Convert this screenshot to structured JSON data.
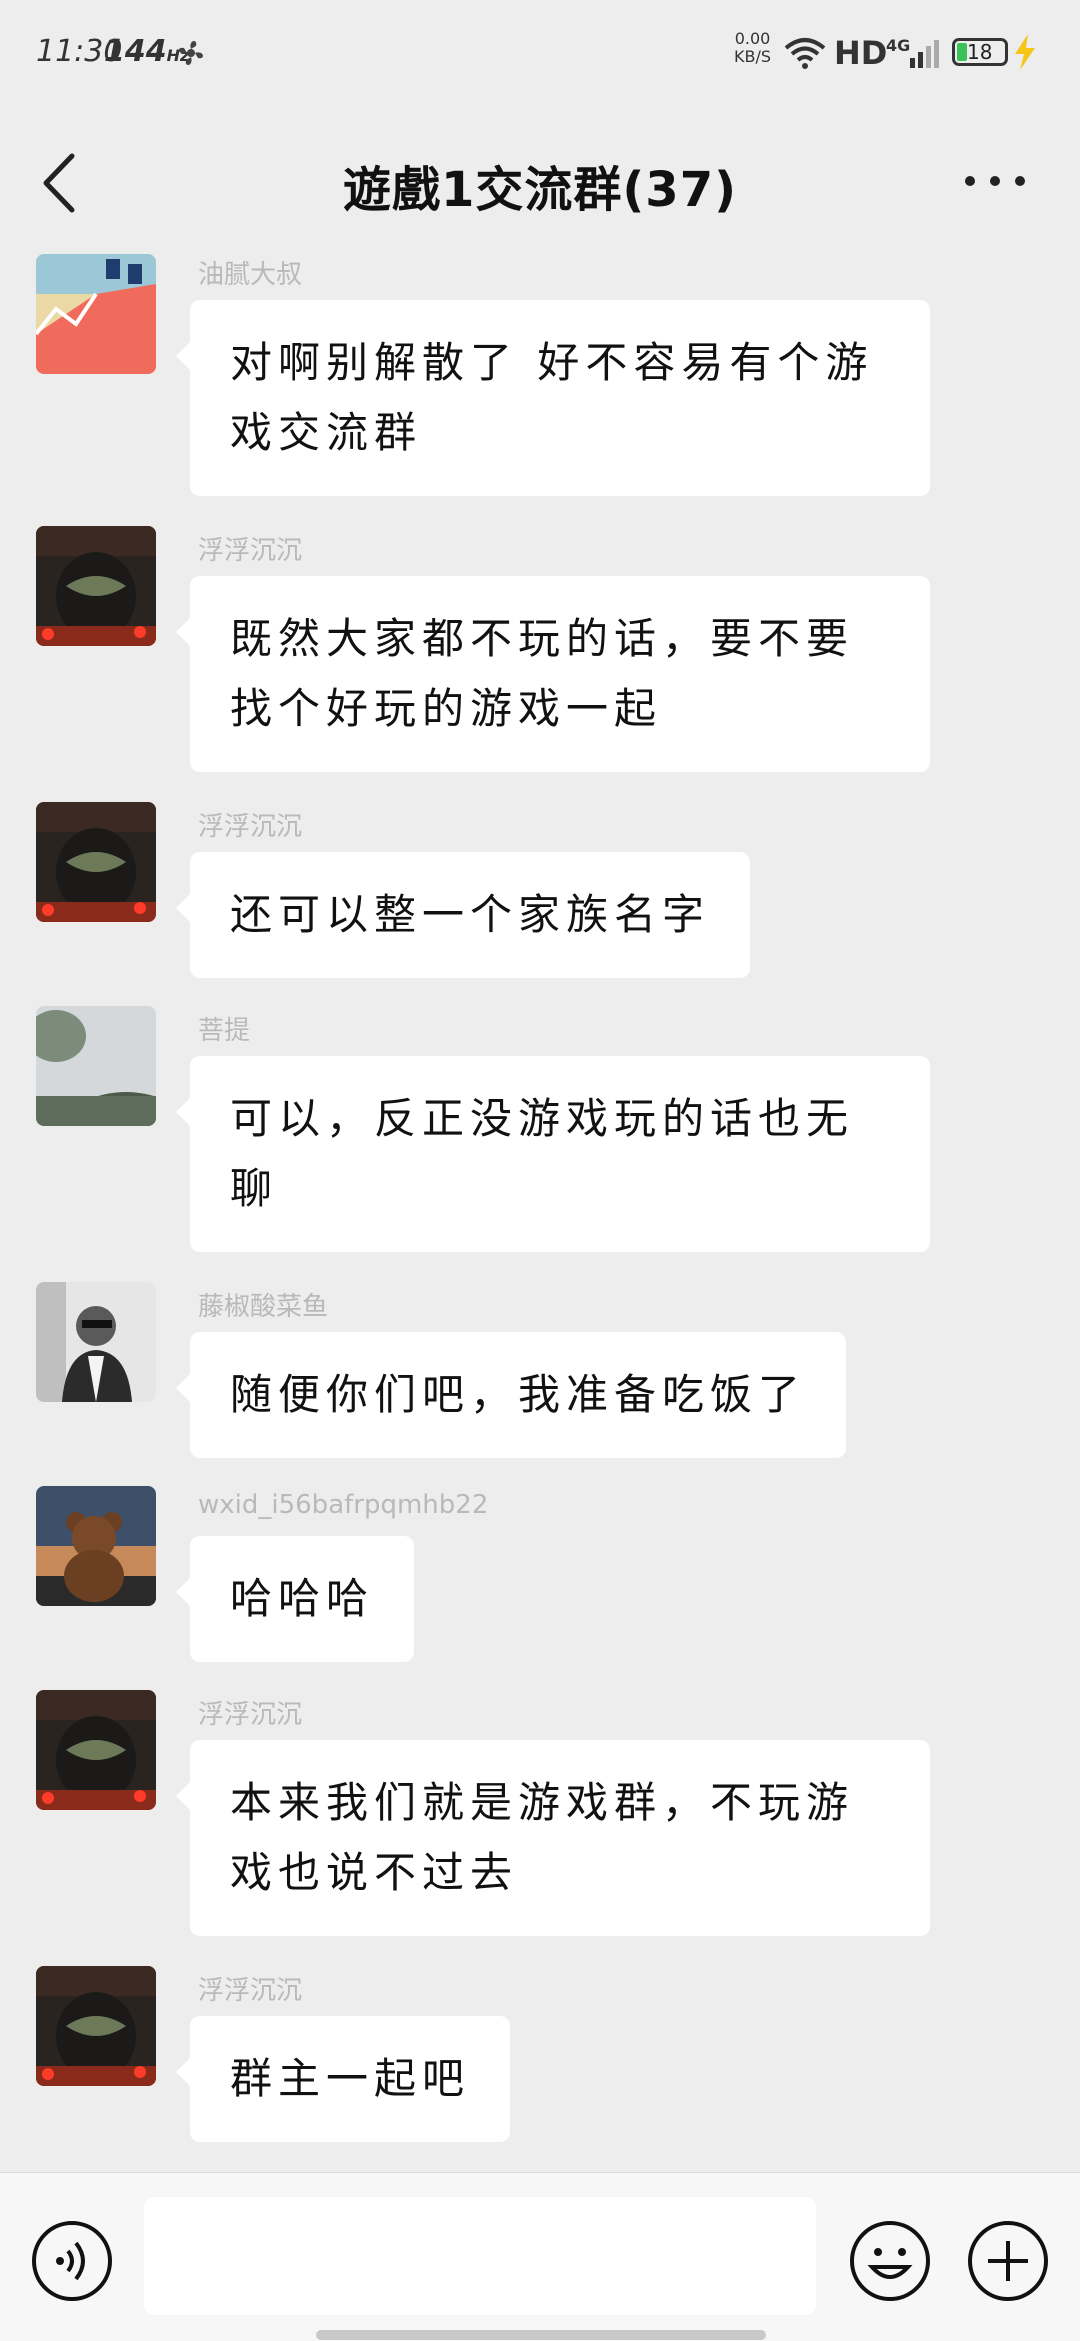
{
  "status_bar": {
    "time": "11:30",
    "refresh_rate": "144",
    "refresh_unit": "Hz",
    "net_speed": "0.00",
    "net_unit": "KB/S",
    "hd": "HD",
    "network": "4G",
    "battery": "18"
  },
  "header": {
    "title": "遊戲1交流群(37)"
  },
  "messages": [
    {
      "sender": "油腻大叔",
      "text": "对啊别解散了 好不容易有个游戏交流群"
    },
    {
      "sender": "浮浮沉沉",
      "text": "既然大家都不玩的话，要不要找个好玩的游戏一起"
    },
    {
      "sender": "浮浮沉沉",
      "text": "还可以整一个家族名字"
    },
    {
      "sender": "菩提",
      "text": "可以，反正没游戏玩的话也无聊"
    },
    {
      "sender": "藤椒酸菜鱼",
      "text": "随便你们吧，我准备吃饭了"
    },
    {
      "sender": "wxid_i56bafrpqmhb22",
      "text": "哈哈哈"
    },
    {
      "sender": "浮浮沉沉",
      "text": "本来我们就是游戏群，不玩游戏也说不过去"
    },
    {
      "sender": "浮浮沉沉",
      "text": "群主一起吧"
    }
  ],
  "input": {
    "value": ""
  },
  "colors": {
    "background": "#EDEDED",
    "bubble": "#FFFFFF",
    "sender_text": "#B9B9B9",
    "battery_fill": "#3BC15A",
    "charging": "#F5C518"
  },
  "icons": [
    "back-arrow-icon",
    "more-icon",
    "voice-icon",
    "emoji-icon",
    "plus-icon",
    "wifi-icon",
    "signal-icon",
    "battery-icon",
    "charging-bolt-icon",
    "fan-icon"
  ]
}
